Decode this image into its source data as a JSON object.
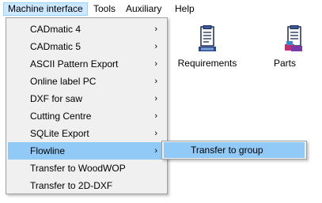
{
  "menubar": {
    "items": [
      {
        "label": "Machine interface"
      },
      {
        "label": "Tools"
      },
      {
        "label": "Auxiliary"
      },
      {
        "label": "Help"
      }
    ]
  },
  "toolbar": {
    "requirements_label": "Requirements",
    "parts_label": "Parts"
  },
  "dropdown": {
    "items": [
      {
        "label": "CADmatic 4",
        "submenu": true
      },
      {
        "label": "CADmatic 5",
        "submenu": true
      },
      {
        "label": "ASCII Pattern Export",
        "submenu": true
      },
      {
        "label": "Online label PC",
        "submenu": true
      },
      {
        "label": "DXF for saw",
        "submenu": true
      },
      {
        "label": "Cutting Centre",
        "submenu": true
      },
      {
        "label": "SQLite Export",
        "submenu": true
      },
      {
        "label": "Flowline",
        "submenu": true,
        "highlighted": true
      },
      {
        "label": "Transfer to WoodWOP",
        "submenu": false
      },
      {
        "label": "Transfer to 2D-DXF",
        "submenu": false
      }
    ]
  },
  "submenu": {
    "items": [
      {
        "label": "Transfer to group"
      }
    ]
  },
  "colors": {
    "highlight": "#91c9f7",
    "menubar_active": "#cce8ff",
    "menu_background": "#f0f0f0"
  }
}
